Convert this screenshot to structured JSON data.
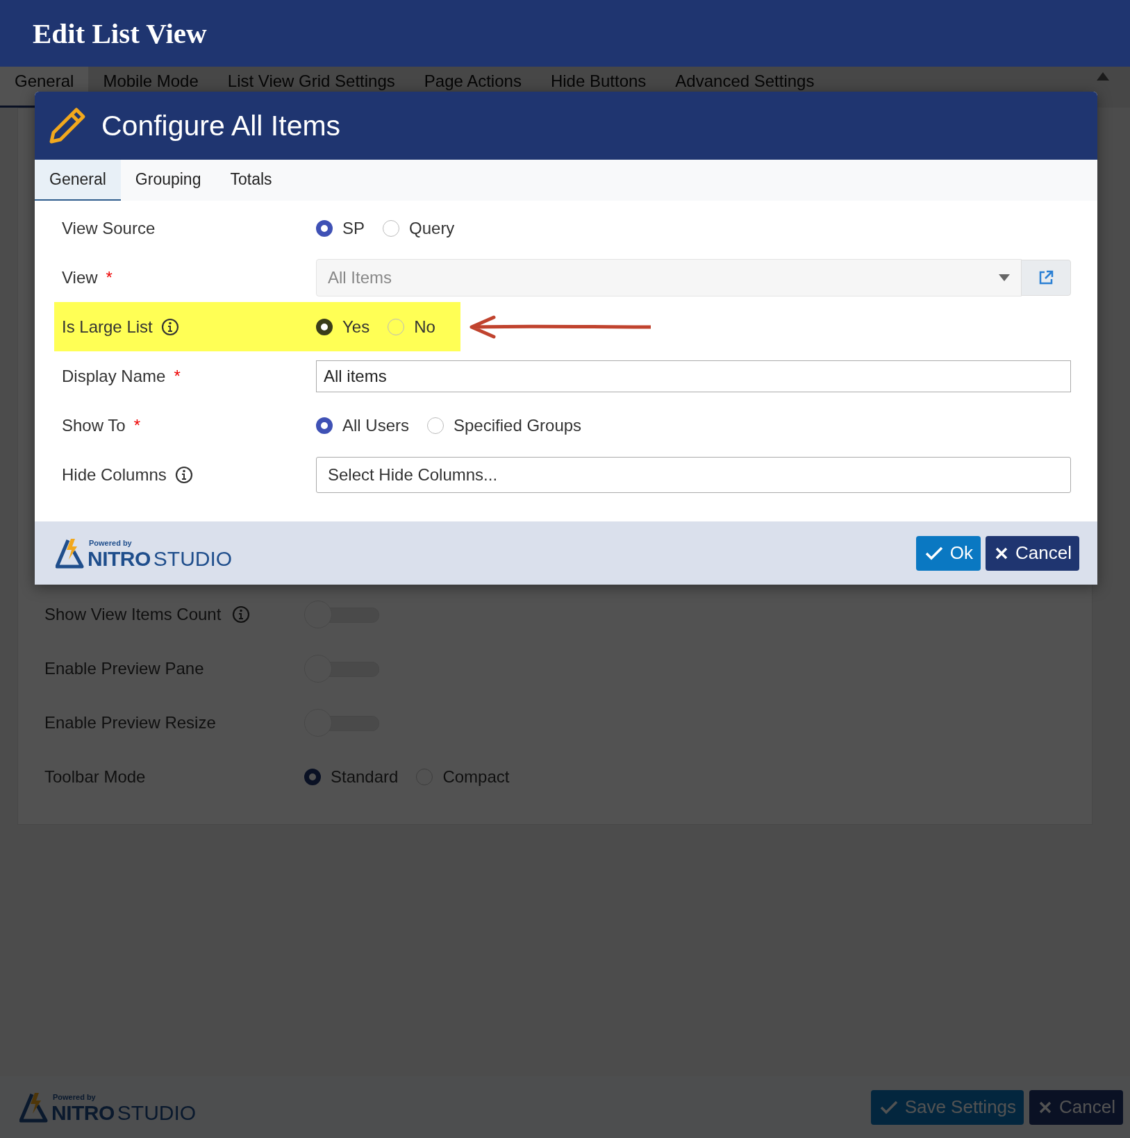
{
  "page": {
    "title": "Edit List View",
    "tabs": [
      {
        "label": "General",
        "selected": true
      },
      {
        "label": "Mobile Mode",
        "selected": false
      },
      {
        "label": "List View Grid Settings",
        "selected": false
      },
      {
        "label": "Page Actions",
        "selected": false
      },
      {
        "label": "Hide Buttons",
        "selected": false
      },
      {
        "label": "Advanced Settings",
        "selected": false
      }
    ],
    "settings": [
      {
        "kind": "toggle",
        "label": "Show View Items Count",
        "info": true,
        "on": false
      },
      {
        "kind": "toggle",
        "label": "Enable Preview Pane",
        "info": false,
        "on": false
      },
      {
        "kind": "toggle",
        "label": "Enable Preview Resize",
        "info": false,
        "on": false
      },
      {
        "kind": "radio",
        "label": "Toolbar Mode",
        "info": false,
        "options": [
          {
            "label": "Standard",
            "selected": true
          },
          {
            "label": "Compact",
            "selected": false
          }
        ]
      }
    ],
    "footer": {
      "logo": {
        "caption": "Powered by",
        "brand": "NITRO",
        "product": "STUDIO"
      },
      "buttons": [
        {
          "kind": "save",
          "label": "Save Settings"
        },
        {
          "kind": "cancel",
          "label": "Cancel"
        }
      ]
    }
  },
  "dialog": {
    "title": "Configure All Items",
    "tabs": [
      {
        "label": "General",
        "selected": true
      },
      {
        "label": "Grouping",
        "selected": false
      },
      {
        "label": "Totals",
        "selected": false
      }
    ],
    "fields": [
      {
        "kind": "radio",
        "label": "View Source",
        "info": false,
        "highlighted": false,
        "pointer_arrow": false,
        "options": [
          {
            "label": "SP",
            "selected": true
          },
          {
            "label": "Query",
            "selected": false
          }
        ]
      },
      {
        "kind": "select",
        "label": "View",
        "required_mark": "*",
        "info": false,
        "highlighted": false,
        "pointer_arrow": false,
        "value": "All Items",
        "disabled": true
      },
      {
        "kind": "radio",
        "label": "Is Large List",
        "info": true,
        "highlighted": true,
        "pointer_arrow": true,
        "options": [
          {
            "label": "Yes",
            "selected": true
          },
          {
            "label": "No",
            "selected": false
          }
        ]
      },
      {
        "kind": "text",
        "label": "Display Name",
        "required_mark": "*",
        "info": false,
        "highlighted": false,
        "pointer_arrow": false,
        "value": "All items"
      },
      {
        "kind": "radio",
        "label": "Show To",
        "required_mark": "*",
        "info": false,
        "highlighted": false,
        "pointer_arrow": false,
        "options": [
          {
            "label": "All Users",
            "selected": true
          },
          {
            "label": "Specified Groups",
            "selected": false
          }
        ]
      },
      {
        "kind": "multiselect",
        "label": "Hide Columns",
        "info": true,
        "highlighted": false,
        "pointer_arrow": false,
        "placeholder": "Select Hide Columns..."
      }
    ],
    "footer": {
      "logo": {
        "caption": "Powered by",
        "brand": "NITRO",
        "product": "STUDIO"
      },
      "buttons": [
        {
          "kind": "ok",
          "label": "Ok"
        },
        {
          "kind": "cancel",
          "label": "Cancel"
        }
      ]
    }
  }
}
